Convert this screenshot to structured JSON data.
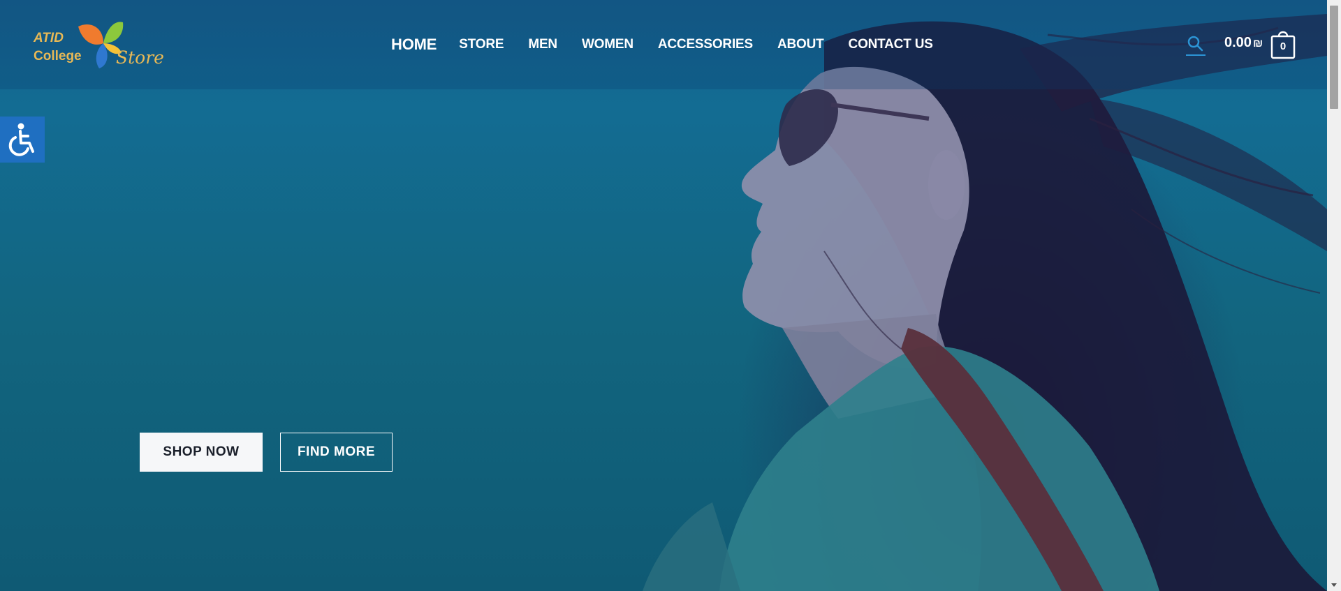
{
  "logo": {
    "line1": "ATID",
    "line2": "College",
    "line3": "Store"
  },
  "nav": {
    "items": [
      {
        "label": "HOME",
        "active": true
      },
      {
        "label": "STORE"
      },
      {
        "label": "MEN"
      },
      {
        "label": "WOMEN"
      },
      {
        "label": "ACCESSORIES"
      },
      {
        "label": "ABOUT"
      },
      {
        "label": "CONTACT US"
      }
    ]
  },
  "header": {
    "search_icon": "search-icon",
    "cart_total": "0.00",
    "currency_symbol": "₪",
    "cart_count": "0",
    "accent": "#2c95d6"
  },
  "accessibility": {
    "icon": "wheelchair-icon",
    "color": "#1f6fc1"
  },
  "hero": {
    "primary_button": "SHOP NOW",
    "secondary_button": "FIND MORE",
    "overlay_color": "#136c93"
  }
}
